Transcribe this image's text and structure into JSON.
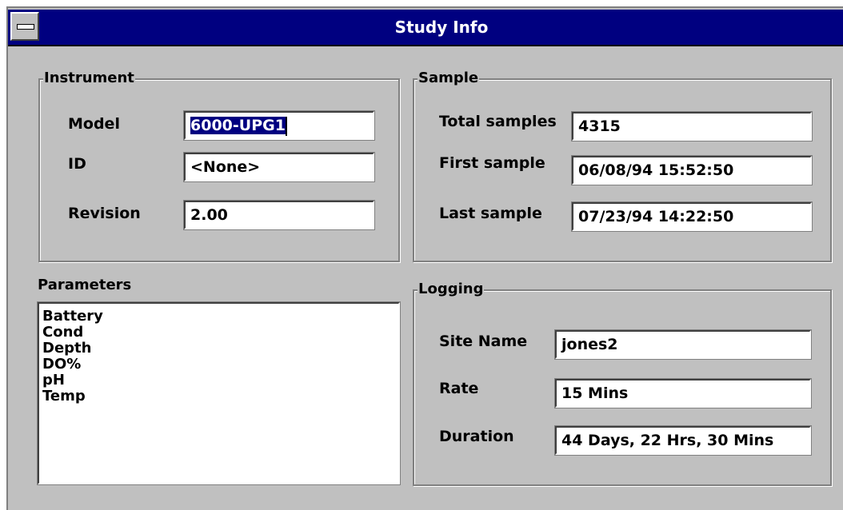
{
  "window": {
    "title": "Study Info"
  },
  "instrument": {
    "label": "Instrument",
    "model_label": "Model",
    "model_value": "6000-UPG1",
    "id_label": "ID",
    "id_value": "<None>",
    "revision_label": "Revision",
    "revision_value": "2.00"
  },
  "sample": {
    "label": "Sample",
    "total_label": "Total samples",
    "total_value": "4315",
    "first_label": "First sample",
    "first_value": "06/08/94 15:52:50",
    "last_label": "Last sample",
    "last_value": "07/23/94 14:22:50"
  },
  "parameters": {
    "label": "Parameters",
    "items": [
      "Battery",
      "Cond",
      "Depth",
      "DO%",
      "pH",
      "Temp"
    ]
  },
  "logging": {
    "label": "Logging",
    "site_label": "Site Name",
    "site_value": "jones2",
    "rate_label": "Rate",
    "rate_value": "15 Mins",
    "duration_label": "Duration",
    "duration_value": "44 Days, 22 Hrs, 30 Mins"
  },
  "colors": {
    "titlebar": "#000080",
    "face": "#c0c0c0",
    "selection": "#000080"
  }
}
